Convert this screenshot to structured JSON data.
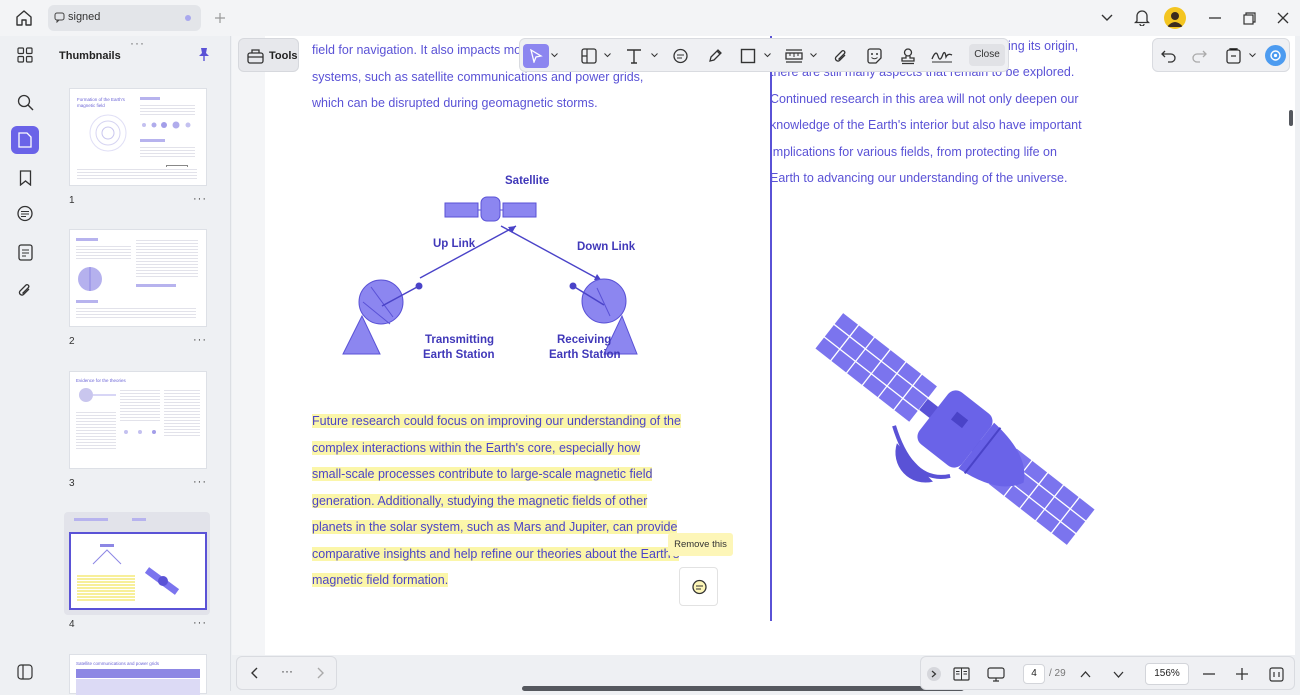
{
  "tab": {
    "title": "signed"
  },
  "thumbnails": {
    "title": "Thumbnails",
    "pages": [
      {
        "num": "1",
        "heading": "Formation of the Earth's magnetic field"
      },
      {
        "num": "2"
      },
      {
        "num": "3",
        "heading": "Evidence for the theories"
      },
      {
        "num": "4"
      },
      {
        "heading": "Satellite communications and power grids"
      }
    ],
    "more": "···"
  },
  "toolbar": {
    "tools_label": "Tools",
    "close_label": "Close"
  },
  "document": {
    "left_top_lines": [
      "field for navigation. It also impacts mo",
      "systems, such as satellite communications and power grids,",
      "which can be disrupted during geomagnetic storms."
    ],
    "right_top_partial": "ing its origin,",
    "right_lines": [
      "there are still many aspects that remain to be explored.",
      "Continued research in this area will not only deepen our",
      "knowledge of the Earth's interior but also have important",
      "implications for various fields, from protecting life on",
      "Earth to advancing our understanding of the universe."
    ],
    "highlighted_lines": [
      "Future research could focus on improving our understanding of the",
      "complex interactions within the Earth's core, especially how",
      "small-scale processes contribute to large-scale magnetic field",
      "generation. Additionally, studying the magnetic fields of other",
      "planets in the solar system, such as Mars and Jupiter, can provide",
      "comparative insights and help refine our theories about the Earth's",
      "magnetic field formation."
    ],
    "diagram": {
      "satellite": "Satellite",
      "uplink": "Up Link",
      "downlink": "Down Link",
      "transmit_1": "Transmitting",
      "transmit_2": "Earth Station",
      "receive_1": "Receiving",
      "receive_2": "Earth Station"
    },
    "comment_tooltip": "Remove this"
  },
  "navigation": {
    "more": "···",
    "current_page": "4",
    "total_pages": "/ 29",
    "zoom": "156%"
  },
  "colors": {
    "accent": "#5a52d6",
    "highlight": "#fbf6a9",
    "illustration": "#7b74ee"
  }
}
